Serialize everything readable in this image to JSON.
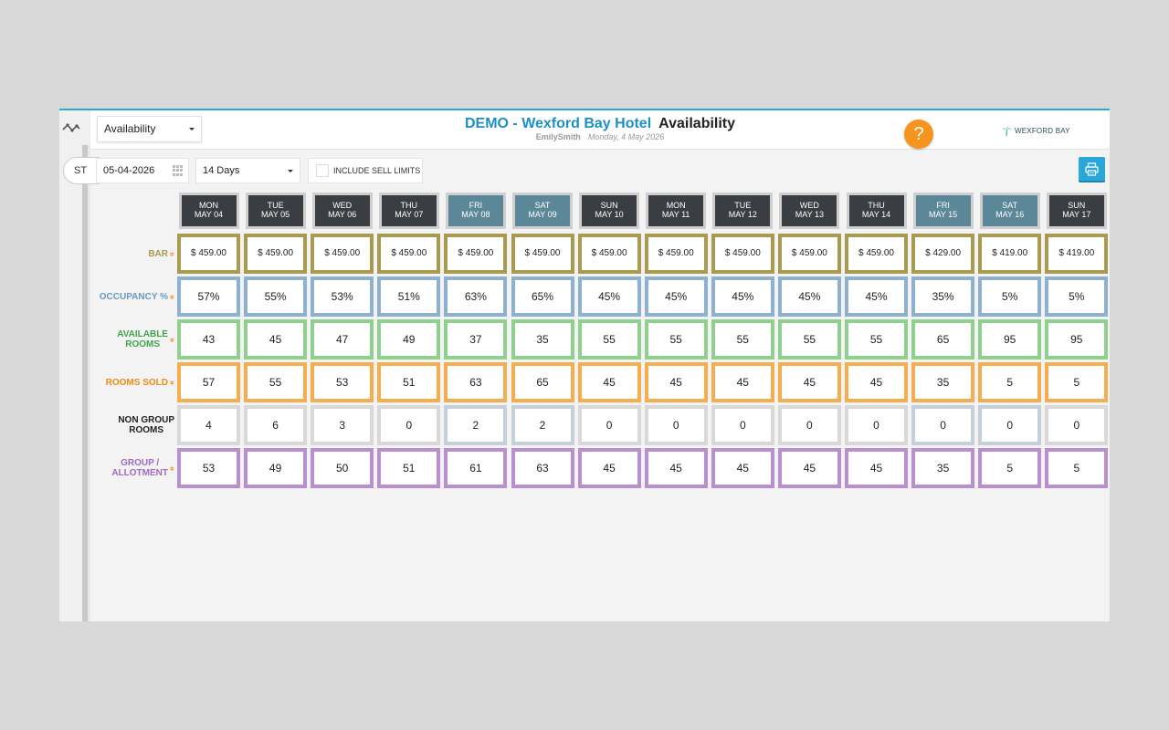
{
  "header": {
    "view_select": "Availability",
    "hotel_name": "DEMO - Wexford Bay Hotel",
    "page_title": "Availability",
    "user_name": "EmilySmith",
    "date_now": "Monday, 4 May 2026",
    "help_label": "?",
    "logo_text": "WEXFORD BAY"
  },
  "rail": {
    "tab_label": "ST"
  },
  "toolbar": {
    "date_value": "05-04-2026",
    "days_select": "14 Days",
    "sell_limits_label": "INCLUDE SELL LIMITS"
  },
  "colors": {
    "weekday_header": "#3a3e42",
    "weekend_header": "#5b8799",
    "bar": "#a89a4e",
    "occupancy": "#8fb1d0",
    "available": "#8fd08f",
    "rooms_sold": "#f4ad4f",
    "non_group": "#d8d8d8",
    "non_group_weekend": "#c5d0da",
    "group": "#b98fd0"
  },
  "days": [
    {
      "dow": "MON",
      "date": "MAY 04",
      "weekend": false
    },
    {
      "dow": "TUE",
      "date": "MAY 05",
      "weekend": false
    },
    {
      "dow": "WED",
      "date": "MAY 06",
      "weekend": false
    },
    {
      "dow": "THU",
      "date": "MAY 07",
      "weekend": false
    },
    {
      "dow": "FRI",
      "date": "MAY 08",
      "weekend": true
    },
    {
      "dow": "SAT",
      "date": "MAY 09",
      "weekend": true
    },
    {
      "dow": "SUN",
      "date": "MAY 10",
      "weekend": false
    },
    {
      "dow": "MON",
      "date": "MAY 11",
      "weekend": false
    },
    {
      "dow": "TUE",
      "date": "MAY 12",
      "weekend": false
    },
    {
      "dow": "WED",
      "date": "MAY 13",
      "weekend": false
    },
    {
      "dow": "THU",
      "date": "MAY 14",
      "weekend": false
    },
    {
      "dow": "FRI",
      "date": "MAY 15",
      "weekend": true
    },
    {
      "dow": "SAT",
      "date": "MAY 16",
      "weekend": true
    },
    {
      "dow": "SUN",
      "date": "MAY 17",
      "weekend": false
    }
  ],
  "rows": [
    {
      "key": "bar",
      "label_lines": [
        "BAR"
      ],
      "expandable": true,
      "label_color": "#a89a4e",
      "values": [
        "$ 459.00",
        "$ 459.00",
        "$ 459.00",
        "$ 459.00",
        "$ 459.00",
        "$ 459.00",
        "$ 459.00",
        "$ 459.00",
        "$ 459.00",
        "$ 459.00",
        "$ 459.00",
        "$ 429.00",
        "$ 419.00",
        "$ 419.00"
      ]
    },
    {
      "key": "occupancy",
      "label_lines": [
        "OCCUPANCY %"
      ],
      "expandable": true,
      "label_color": "#6a9ac2",
      "values": [
        "57%",
        "55%",
        "53%",
        "51%",
        "63%",
        "65%",
        "45%",
        "45%",
        "45%",
        "45%",
        "45%",
        "35%",
        "5%",
        "5%"
      ]
    },
    {
      "key": "available",
      "label_lines": [
        "AVAILABLE",
        "ROOMS"
      ],
      "expandable": true,
      "label_color": "#3fa64a",
      "values": [
        "43",
        "45",
        "47",
        "49",
        "37",
        "35",
        "55",
        "55",
        "55",
        "55",
        "55",
        "65",
        "95",
        "95"
      ]
    },
    {
      "key": "rooms_sold",
      "label_lines": [
        "ROOMS SOLD"
      ],
      "expandable": true,
      "label_color": "#ef8a14",
      "values": [
        "57",
        "55",
        "53",
        "51",
        "63",
        "65",
        "45",
        "45",
        "45",
        "45",
        "45",
        "35",
        "5",
        "5"
      ]
    },
    {
      "key": "non_group",
      "label_lines": [
        "NON GROUP",
        "ROOMS"
      ],
      "expandable": false,
      "label_color": "#222222",
      "values": [
        "4",
        "6",
        "3",
        "0",
        "2",
        "2",
        "0",
        "0",
        "0",
        "0",
        "0",
        "0",
        "0",
        "0"
      ]
    },
    {
      "key": "group",
      "label_lines": [
        "GROUP /",
        "ALLOTMENT"
      ],
      "expandable": true,
      "label_color": "#a06cc0",
      "values": [
        "53",
        "49",
        "50",
        "51",
        "61",
        "63",
        "45",
        "45",
        "45",
        "45",
        "45",
        "35",
        "5",
        "5"
      ]
    }
  ]
}
